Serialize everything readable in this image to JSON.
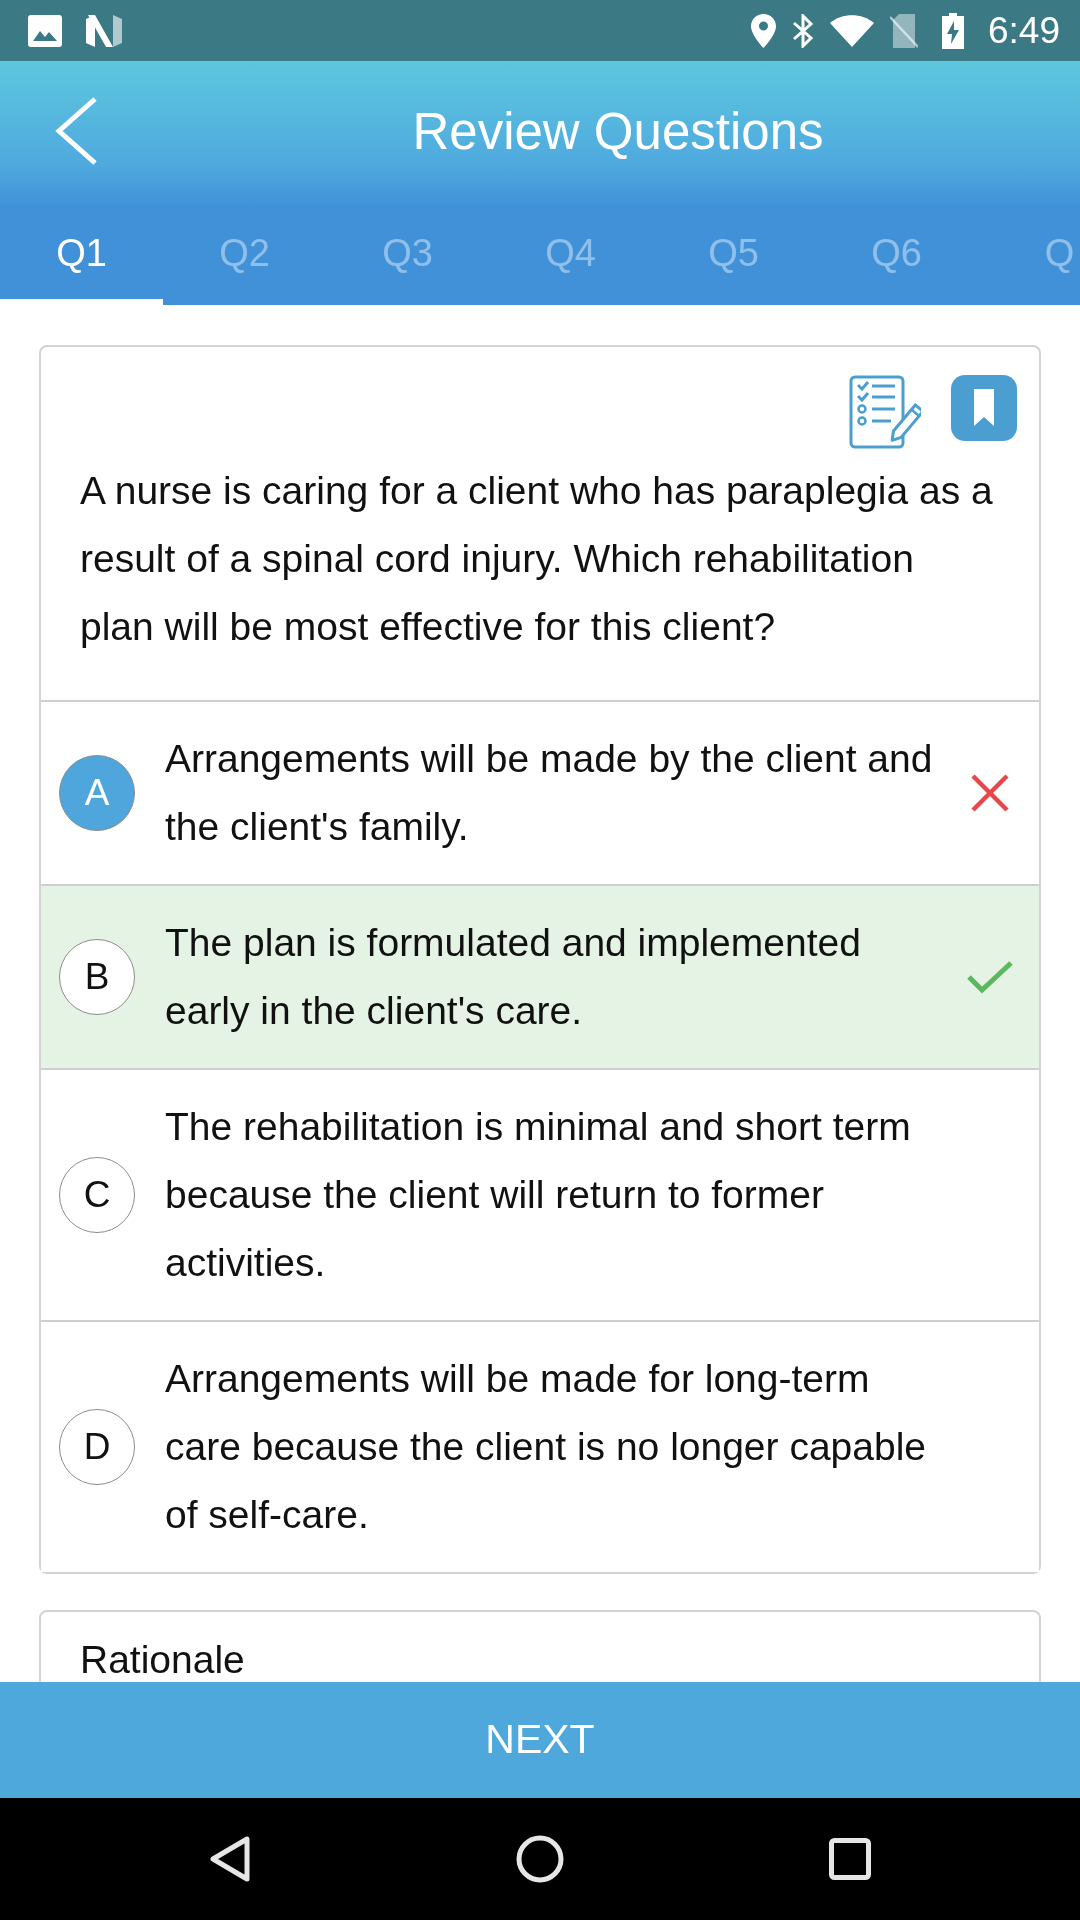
{
  "status_bar": {
    "time": "6:49"
  },
  "app_bar": {
    "title": "Review Questions"
  },
  "tabs": [
    {
      "label": "Q1",
      "selected": true
    },
    {
      "label": "Q2",
      "selected": false
    },
    {
      "label": "Q3",
      "selected": false
    },
    {
      "label": "Q4",
      "selected": false
    },
    {
      "label": "Q5",
      "selected": false
    },
    {
      "label": "Q6",
      "selected": false
    },
    {
      "label": "Q",
      "selected": false
    }
  ],
  "question": {
    "text": "A nurse is caring for a client who has paraplegia as a result of a spinal cord injury. Which rehabilitation plan will be most effective for this client?"
  },
  "options": [
    {
      "letter": "A",
      "text": "Arrangements will be made by the client and the client's family.",
      "selected": true,
      "correct": false
    },
    {
      "letter": "B",
      "text": "The plan is formulated and implemented early in the client's care.",
      "selected": false,
      "correct": true
    },
    {
      "letter": "C",
      "text": "The rehabilitation is minimal and short term because the client will return to former activities.",
      "selected": false,
      "correct": false
    },
    {
      "letter": "D",
      "text": "Arrangements will be made for long-term care because the client is no longer capable of self-care.",
      "selected": false,
      "correct": false
    }
  ],
  "rationale": {
    "title": "Rationale"
  },
  "next_button": {
    "label": "NEXT"
  }
}
